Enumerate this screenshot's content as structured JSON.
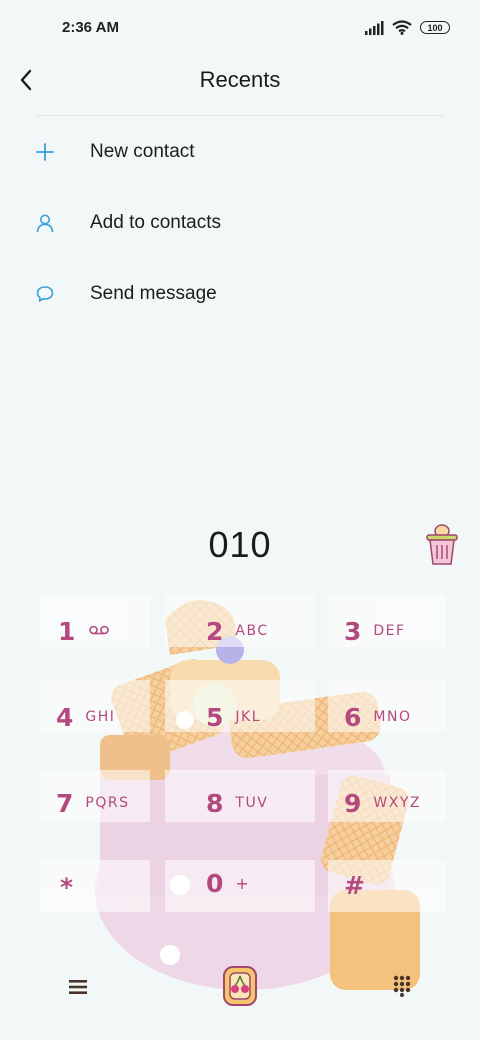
{
  "status": {
    "time": "2:36 AM",
    "battery": "100"
  },
  "header": {
    "title": "Recents"
  },
  "actions": [
    {
      "label": "New contact",
      "icon": "plus-icon"
    },
    {
      "label": "Add to contacts",
      "icon": "person-icon"
    },
    {
      "label": "Send message",
      "icon": "message-bubble-icon"
    }
  ],
  "dialer": {
    "number": "010",
    "keys": [
      {
        "digit": "1",
        "letters": ""
      },
      {
        "digit": "2",
        "letters": "ABC"
      },
      {
        "digit": "3",
        "letters": "DEF"
      },
      {
        "digit": "4",
        "letters": "GHI"
      },
      {
        "digit": "5",
        "letters": "JKL"
      },
      {
        "digit": "6",
        "letters": "MNO"
      },
      {
        "digit": "7",
        "letters": "PQRS"
      },
      {
        "digit": "8",
        "letters": "TUV"
      },
      {
        "digit": "9",
        "letters": "WXYZ"
      },
      {
        "digit": "*",
        "letters": ""
      },
      {
        "digit": "0",
        "letters": "+"
      },
      {
        "digit": "#",
        "letters": ""
      }
    ]
  },
  "colors": {
    "accent": "#3aa0dc",
    "keypad": "#b3497f",
    "background": "#f2f7f8"
  }
}
